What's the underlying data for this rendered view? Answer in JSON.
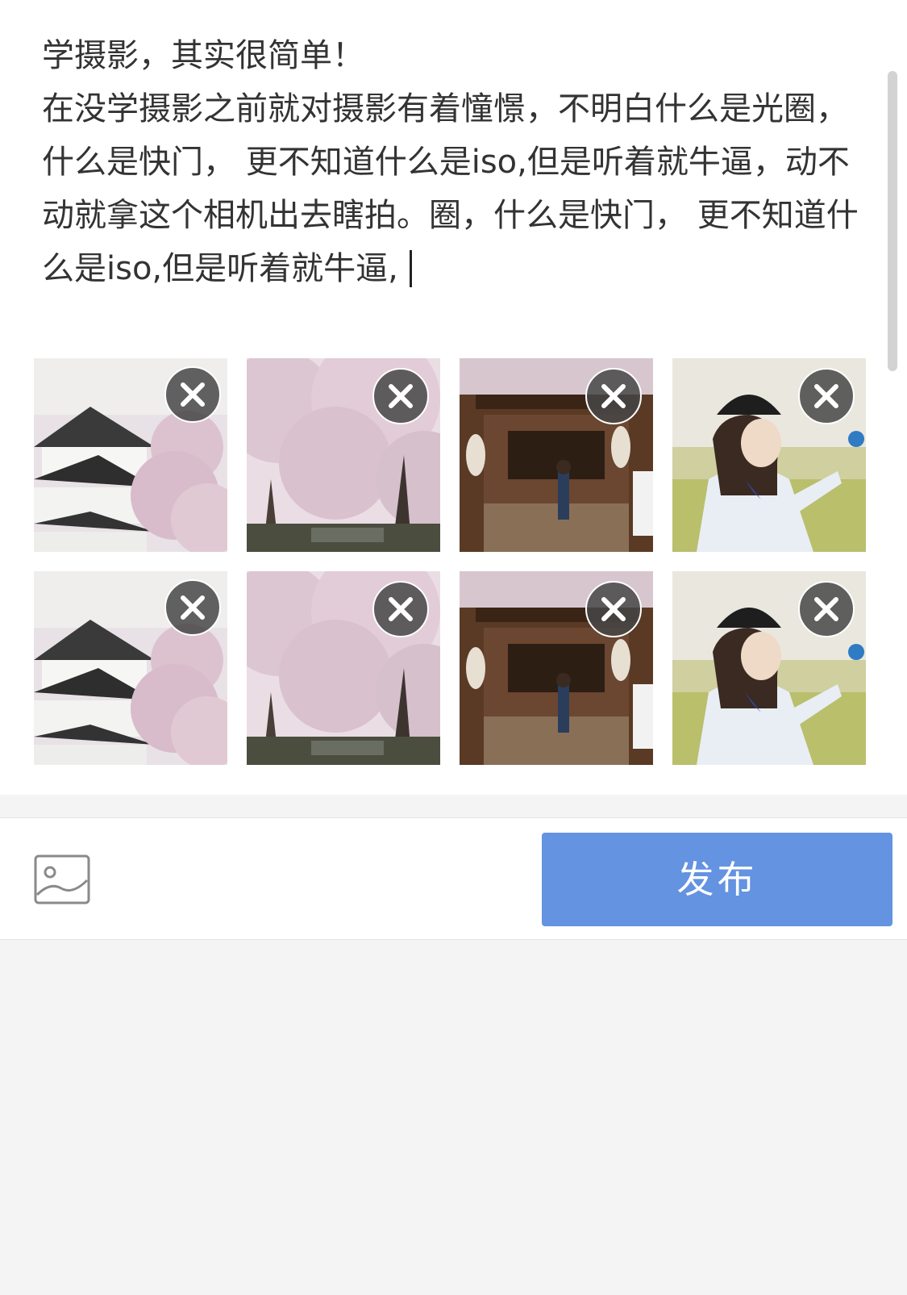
{
  "post_text": {
    "lines": [
      "学摄影，其实很简单！",
      "在没学摄影之前就对摄影有着憧憬，不明白什么是光圈，什么是快门， 更不知道什么是iso,但是听着就牛逼，动不动就拿这个相机出去瞎拍。圈，什么是快门， 更不知道什么是iso,但是听着就牛逼,"
    ]
  },
  "images": [
    {
      "subject": "castle-sakura"
    },
    {
      "subject": "sakura-avenue"
    },
    {
      "subject": "shrine"
    },
    {
      "subject": "girl-portrait"
    },
    {
      "subject": "castle-sakura"
    },
    {
      "subject": "sakura-avenue"
    },
    {
      "subject": "shrine"
    },
    {
      "subject": "girl-portrait"
    }
  ],
  "toolbar": {
    "image_icon": "image-icon",
    "publish_label": "发布"
  },
  "colors": {
    "accent": "#6393e1",
    "background": "#f4f4f4",
    "text": "#333333"
  }
}
